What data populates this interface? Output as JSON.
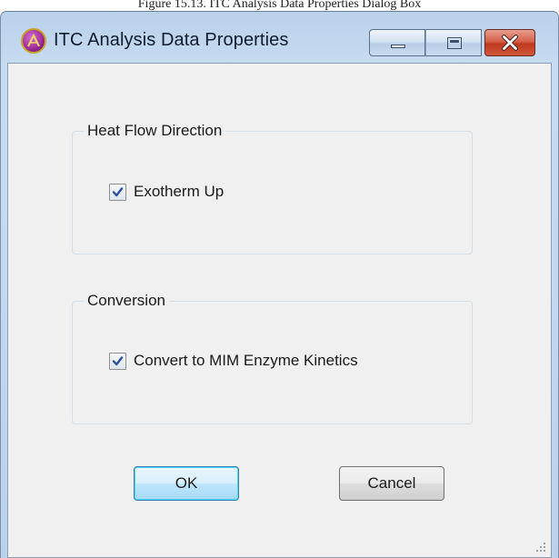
{
  "caption": "Figure 15.13. ITC Analysis Data Properties Dialog Box",
  "window": {
    "title": "ITC Analysis Data Properties",
    "app_icon": "itc-app-icon",
    "controls": {
      "minimize_icon": "minimize-icon",
      "maximize_icon": "maximize-icon",
      "close_icon": "close-icon"
    }
  },
  "groups": {
    "heat_flow": {
      "title": "Heat Flow Direction",
      "checkbox": {
        "label": "Exotherm Up",
        "checked": true
      }
    },
    "conversion": {
      "title": "Conversion",
      "checkbox": {
        "label": "Convert to MIM Enzyme Kinetics",
        "checked": true
      }
    }
  },
  "buttons": {
    "ok": "OK",
    "cancel": "Cancel"
  },
  "colors": {
    "frame": "#b9d1ea",
    "client": "#f0f0f0",
    "close_button": "#c0391e",
    "default_button": "#bee6fd"
  }
}
